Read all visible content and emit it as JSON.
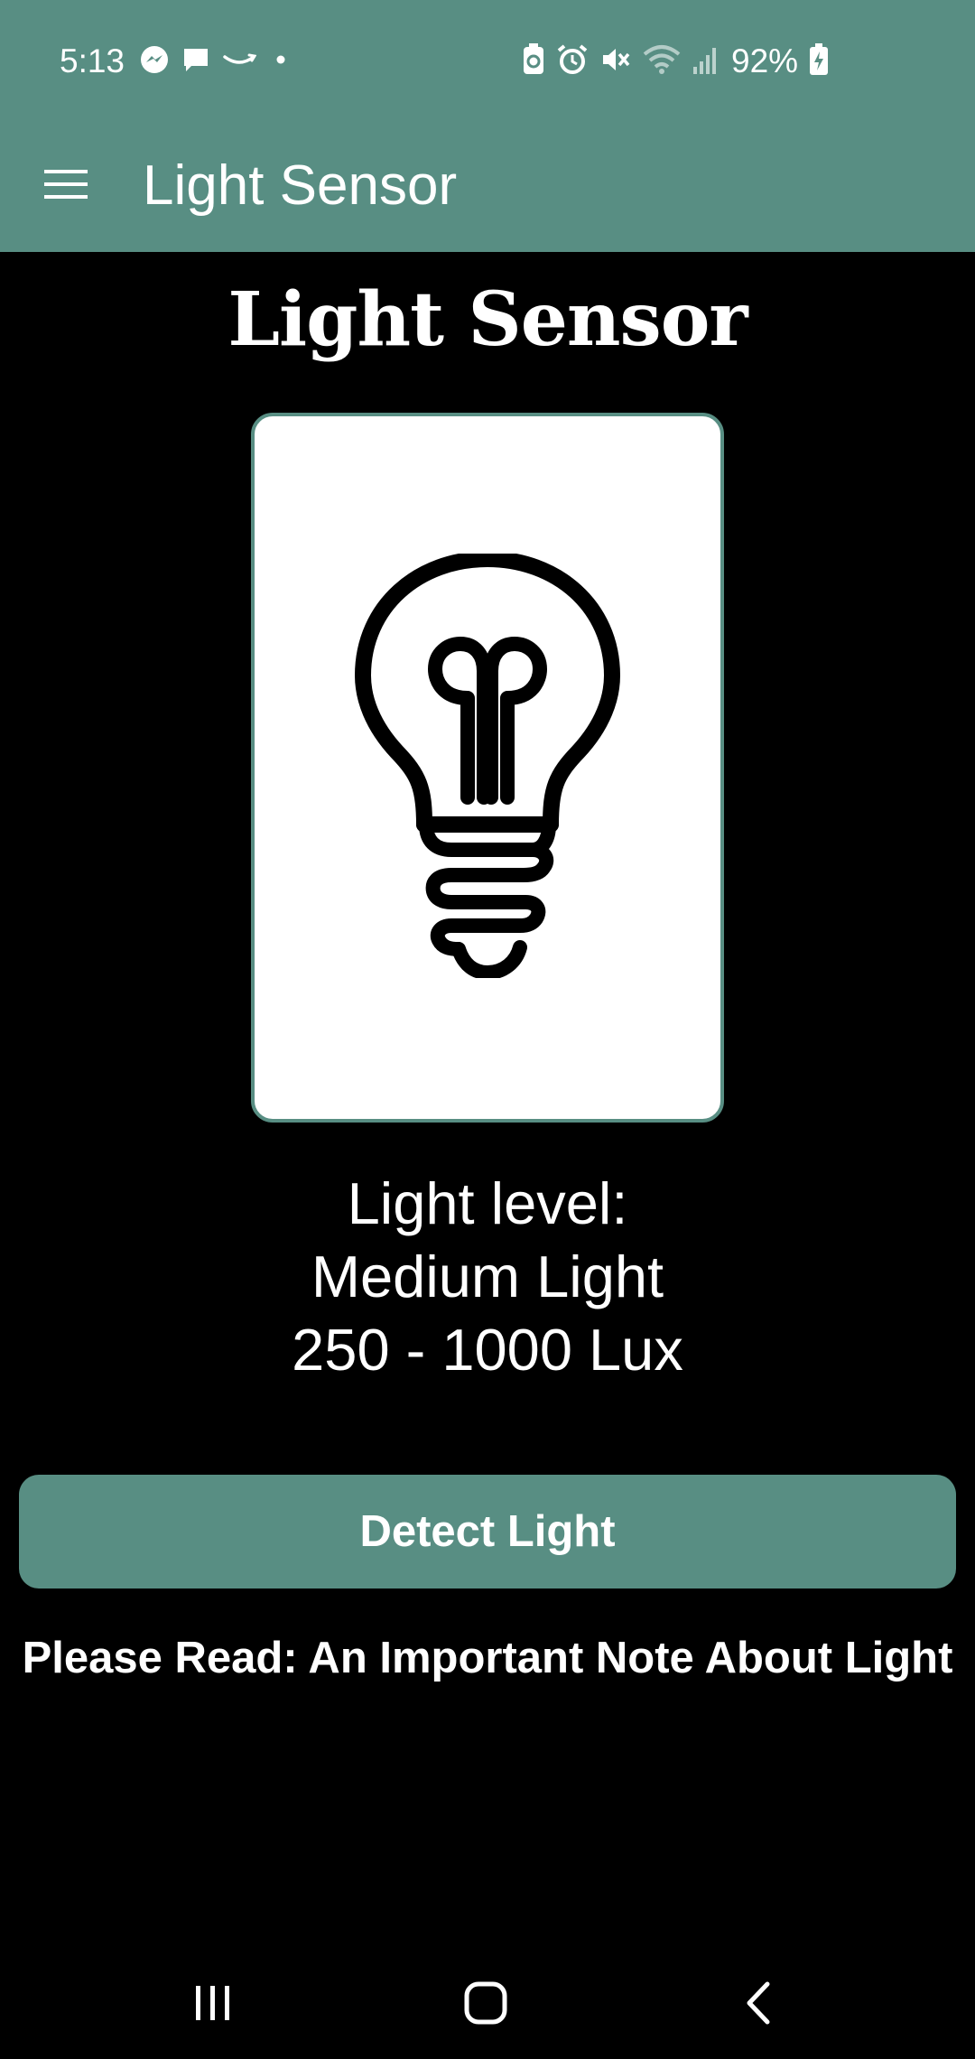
{
  "status_bar": {
    "time": "5:13",
    "battery": "92%",
    "left_icons": [
      "messenger-icon",
      "chat-bubble-icon",
      "amazon-smile-icon",
      "dot-icon"
    ],
    "right_icons": [
      "battery-saver-icon",
      "alarm-icon",
      "mute-icon",
      "wifi-icon",
      "signal-icon",
      "battery-charging-icon"
    ]
  },
  "app_bar": {
    "title": "Light Sensor",
    "menu_icon": "hamburger-menu-icon"
  },
  "main": {
    "heading": "Light Sensor",
    "image_icon": "light-bulb-icon",
    "level_label": "Light level:",
    "level_name": "Medium Light",
    "level_range": "250 - 1000 Lux",
    "detect_button_label": "Detect Light",
    "note_link": "Please Read: An Important Note About Light"
  },
  "nav_bar": {
    "items": [
      "recent-apps-icon",
      "home-icon",
      "back-icon"
    ]
  },
  "colors": {
    "accent": "#588e83",
    "background": "#000000",
    "text": "#ffffff"
  }
}
